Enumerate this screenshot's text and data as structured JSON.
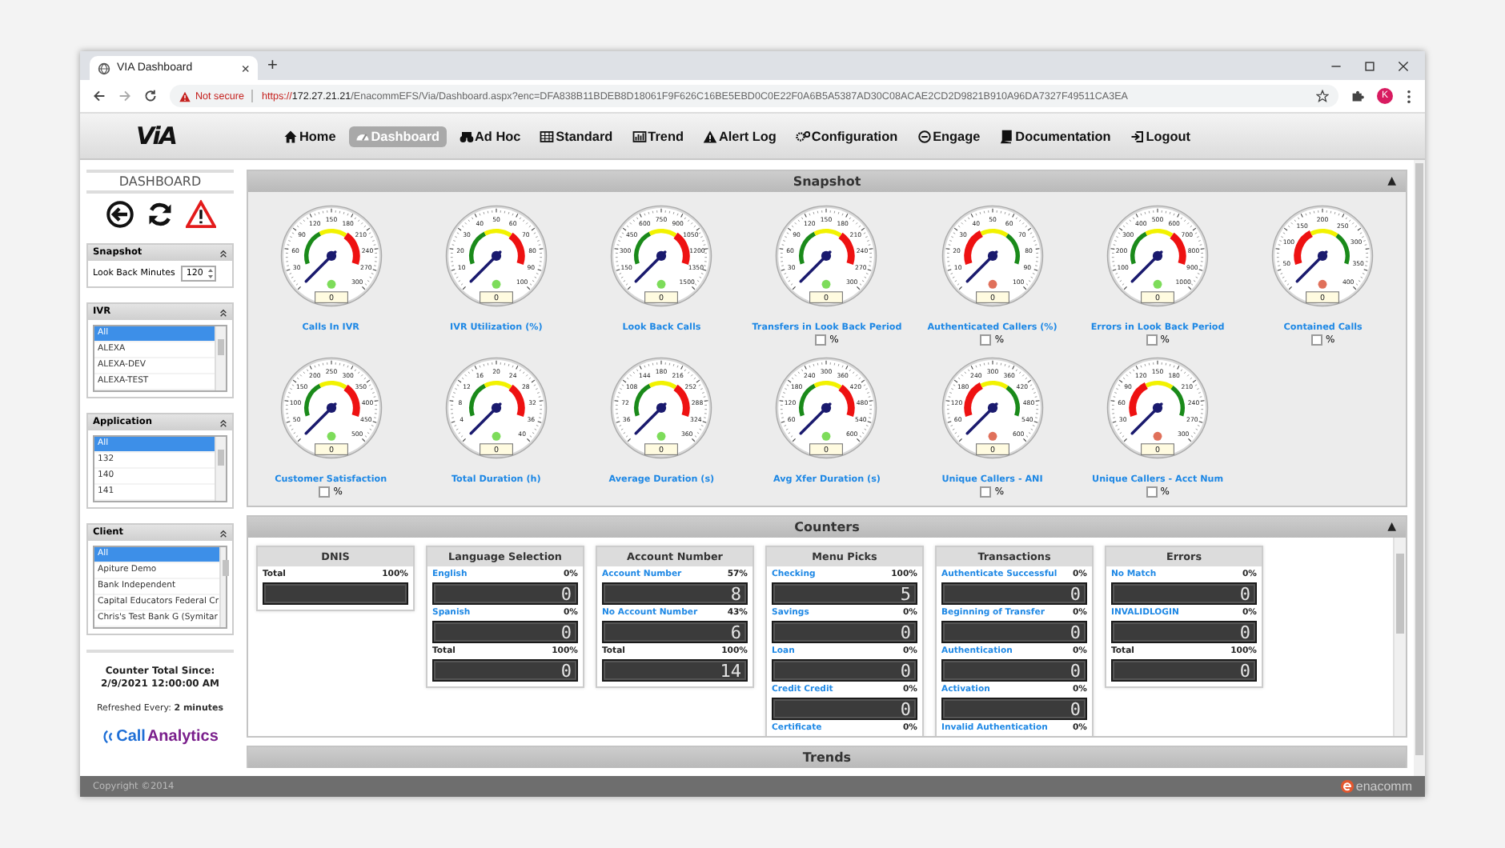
{
  "browser": {
    "tab_title": "VIA Dashboard",
    "tab_close": "×",
    "new_tab": "+",
    "security": "Not secure",
    "url_scheme": "https://",
    "url_host": "172.27.21.21",
    "url_path": "/EnacommEFS/Via/Dashboard.aspx?enc=DFA838B11BDEB8D18061F9F626C16BE5EBD0C0E22F0A6B5A5387AD30C08ACAE2CD2D9821B910A96DA7327F49511CA3EA",
    "profile_initial": "K"
  },
  "app": {
    "logo": "ViA",
    "nav": [
      {
        "label": "Home",
        "selected": false
      },
      {
        "label": "Dashboard",
        "selected": true
      },
      {
        "label": "Ad Hoc",
        "selected": false
      },
      {
        "label": "Standard",
        "selected": false
      },
      {
        "label": "Trend",
        "selected": false
      },
      {
        "label": "Alert Log",
        "selected": false
      },
      {
        "label": "Configuration",
        "selected": false
      },
      {
        "label": "Engage",
        "selected": false
      },
      {
        "label": "Documentation",
        "selected": false
      },
      {
        "label": "Logout",
        "selected": false
      }
    ]
  },
  "sidebar": {
    "title": "DASHBOARD",
    "snapshot": {
      "title": "Snapshot",
      "field_label": "Look Back Minutes",
      "value": "120"
    },
    "lists": [
      {
        "title": "IVR",
        "items": [
          {
            "label": "All",
            "selected": true
          },
          {
            "label": "ALEXA",
            "selected": false
          },
          {
            "label": "ALEXA-DEV",
            "selected": false
          },
          {
            "label": "ALEXA-TEST",
            "selected": false
          }
        ]
      },
      {
        "title": "Application",
        "items": [
          {
            "label": "All",
            "selected": true
          },
          {
            "label": "132",
            "selected": false
          },
          {
            "label": "140",
            "selected": false
          },
          {
            "label": "141",
            "selected": false
          }
        ]
      },
      {
        "title": "Client",
        "items": [
          {
            "label": "All",
            "selected": true
          },
          {
            "label": "Apiture Demo",
            "selected": false
          },
          {
            "label": "Bank Independent",
            "selected": false
          },
          {
            "label": "Capital Educators Federal Cr",
            "selected": false
          },
          {
            "label": "Chris's Test Bank G (Symitar",
            "selected": false
          }
        ]
      }
    ],
    "counter_total_label": "Counter Total Since:",
    "counter_total_date": "2/9/2021 12:00:00 AM",
    "refresh": "Refreshed Every: **2 minutes**",
    "logo_call": "Call",
    "logo_analytics": "Analytics"
  },
  "snapshot": {
    "title": "Snapshot",
    "collapse": "▲",
    "gauges": [
      {
        "label": "Calls In IVR",
        "kind": "normal",
        "ticks": [
          "30",
          "60",
          "90",
          "120",
          "150",
          "180",
          "210",
          "240",
          "270",
          "300"
        ],
        "color": "#7ddc5a",
        "value": "0"
      },
      {
        "label": "IVR Utilization (%)",
        "kind": "normal",
        "ticks": [
          "10",
          "20",
          "30",
          "40",
          "50",
          "60",
          "70",
          "80",
          "90",
          "100"
        ],
        "color": "#7ddc5a",
        "value": "0"
      },
      {
        "label": "Look Back Calls",
        "kind": "normal",
        "ticks": [
          "150",
          "300",
          "450",
          "600",
          "750",
          "900",
          "1050",
          "1200",
          "1350",
          "1500"
        ],
        "color": "#7ddc5a",
        "value": "0"
      },
      {
        "label": "Transfers in Look Back Period",
        "kind": "normal",
        "ticks": [
          "30",
          "60",
          "90",
          "120",
          "150",
          "180",
          "210",
          "240",
          "270",
          "300"
        ],
        "color": "#7ddc5a",
        "value": "0",
        "checkbox": {
          "label": "%",
          "checked": false
        }
      },
      {
        "label": "Authenticated Callers (%)",
        "kind": "reversed",
        "ticks": [
          "10",
          "20",
          "30",
          "40",
          "50",
          "60",
          "70",
          "80",
          "90",
          "100"
        ],
        "color": "#e0705a",
        "value": "0",
        "checkbox": {
          "label": "%",
          "checked": false
        }
      },
      {
        "label": "Errors in Look Back Period",
        "kind": "normal",
        "ticks": [
          "100",
          "200",
          "300",
          "400",
          "500",
          "600",
          "700",
          "800",
          "900",
          "1000"
        ],
        "color": "#7ddc5a",
        "value": "0",
        "checkbox": {
          "label": "%",
          "checked": false
        }
      },
      {
        "label": "Contained Calls",
        "kind": "reversed",
        "ticks": [
          "50",
          "100",
          "150",
          "200",
          "250",
          "300",
          "350",
          "400"
        ],
        "color": "#e0705a",
        "value": "0",
        "checkbox": {
          "label": "%",
          "checked": false
        }
      },
      {
        "label": "Customer Satisfaction",
        "kind": "normal",
        "ticks": [
          "50",
          "100",
          "150",
          "200",
          "250",
          "300",
          "350",
          "400",
          "450",
          "500"
        ],
        "color": "#7ddc5a",
        "value": "0",
        "checkbox": {
          "label": "%",
          "checked": false
        }
      },
      {
        "label": "Total Duration (h)",
        "kind": "normal",
        "ticks": [
          "4",
          "8",
          "12",
          "16",
          "20",
          "24",
          "28",
          "32",
          "36",
          "40"
        ],
        "color": "#7ddc5a",
        "value": "0"
      },
      {
        "label": "Average Duration (s)",
        "kind": "normal",
        "ticks": [
          "36",
          "72",
          "108",
          "144",
          "180",
          "216",
          "252",
          "288",
          "324",
          "360"
        ],
        "color": "#7ddc5a",
        "value": "0"
      },
      {
        "label": "Avg Xfer Duration (s)",
        "kind": "normal",
        "ticks": [
          "60",
          "120",
          "180",
          "240",
          "300",
          "360",
          "420",
          "480",
          "540",
          "600"
        ],
        "color": "#7ddc5a",
        "value": "0"
      },
      {
        "label": "Unique Callers - ANI",
        "kind": "reversed",
        "ticks": [
          "60",
          "120",
          "180",
          "240",
          "300",
          "360",
          "420",
          "480",
          "540",
          "600"
        ],
        "color": "#e0705a",
        "value": "0",
        "checkbox": {
          "label": "%",
          "checked": false
        }
      },
      {
        "label": "Unique Callers - Acct Num",
        "kind": "reversed",
        "ticks": [
          "30",
          "60",
          "90",
          "120",
          "150",
          "180",
          "210",
          "240",
          "270",
          "300"
        ],
        "color": "#e0705a",
        "value": "0",
        "checkbox": {
          "label": "%",
          "checked": false
        }
      }
    ]
  },
  "counters": {
    "title": "Counters",
    "collapse": "▲",
    "cards": [
      {
        "title": "DNIS",
        "rows": [
          {
            "kind": "total",
            "label": "Total",
            "percent": "100%"
          }
        ]
      },
      {
        "title": "Language Selection",
        "rows": [
          {
            "kind": "item",
            "label": "English",
            "percent": "0%",
            "value": "0"
          },
          {
            "kind": "item",
            "label": "Spanish",
            "percent": "0%",
            "value": "0"
          },
          {
            "kind": "total",
            "label": "Total",
            "percent": "100%",
            "value": "0"
          }
        ]
      },
      {
        "title": "Account Number",
        "rows": [
          {
            "kind": "item",
            "label": "Account Number",
            "percent": "57%",
            "value": "8"
          },
          {
            "kind": "item",
            "label": "No Account Number",
            "percent": "43%",
            "value": "6"
          },
          {
            "kind": "total",
            "label": "Total",
            "percent": "100%",
            "value": "14"
          }
        ]
      },
      {
        "title": "Menu Picks",
        "rows": [
          {
            "kind": "item",
            "label": "Checking",
            "percent": "100%",
            "value": "5"
          },
          {
            "kind": "item",
            "label": "Savings",
            "percent": "0%",
            "value": "0"
          },
          {
            "kind": "item",
            "label": "Loan",
            "percent": "0%",
            "value": "0"
          },
          {
            "kind": "item",
            "label": "Credit Credit",
            "percent": "0%",
            "value": "0"
          },
          {
            "kind": "item",
            "label": "Certificate",
            "percent": "0%"
          }
        ]
      },
      {
        "title": "Transactions",
        "rows": [
          {
            "kind": "item",
            "label": "Authenticate Successful",
            "percent": "0%",
            "value": "0"
          },
          {
            "kind": "item",
            "label": "Beginning of Transfer",
            "percent": "0%",
            "value": "0"
          },
          {
            "kind": "item",
            "label": "Authentication",
            "percent": "0%",
            "value": "0"
          },
          {
            "kind": "item",
            "label": "Activation",
            "percent": "0%",
            "value": "0"
          },
          {
            "kind": "item",
            "label": "Invalid Authentication",
            "percent": "0%"
          }
        ]
      },
      {
        "title": "Errors",
        "rows": [
          {
            "kind": "item",
            "label": "No Match",
            "percent": "0%",
            "value": "0"
          },
          {
            "kind": "item",
            "label": "INVALIDLOGIN",
            "percent": "0%",
            "value": "0"
          },
          {
            "kind": "total",
            "label": "Total",
            "percent": "100%",
            "value": "0"
          }
        ]
      }
    ]
  },
  "trends": {
    "title": "Trends"
  },
  "footer": {
    "copyright": "Copyright ©2014",
    "brand": "enacomm"
  }
}
